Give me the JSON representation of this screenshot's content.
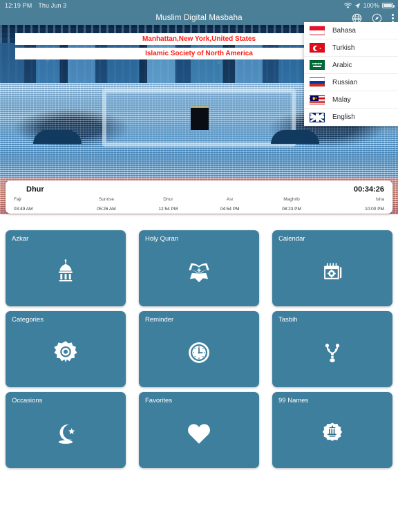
{
  "status_bar": {
    "time": "12:19 PM",
    "date": "Thu Jun 3",
    "battery": "100%",
    "wifi_icon": "wifi-icon",
    "location_icon": "location-arrow-icon",
    "battery_icon": "battery-full-icon"
  },
  "app_bar": {
    "title": "Muslim Digital Masbaha",
    "actions": [
      {
        "name": "globe-icon",
        "label": "Language"
      },
      {
        "name": "compass-icon",
        "label": "Qibla"
      },
      {
        "name": "overflow-menu-icon",
        "label": "More"
      }
    ]
  },
  "hero": {
    "city_banner": "Manhattan,New York,United States",
    "org_banner": "Islamic Society of North America",
    "banner_color": "#ff1a0f"
  },
  "language_menu": {
    "items": [
      {
        "label": "Bahasa",
        "flag": "flag-indonesia"
      },
      {
        "label": "Turkish",
        "flag": "flag-turkey"
      },
      {
        "label": "Arabic",
        "flag": "flag-saudi-arabia"
      },
      {
        "label": "Russian",
        "flag": "flag-russia"
      },
      {
        "label": "Malay",
        "flag": "flag-malaysia"
      },
      {
        "label": "English",
        "flag": "flag-united-kingdom"
      }
    ]
  },
  "prayer_card": {
    "next_prayer": "Dhur",
    "countdown": "00:34:26",
    "times": [
      {
        "name": "Fajr",
        "time": "03:49 AM"
      },
      {
        "name": "Sunrise",
        "time": "05:26 AM"
      },
      {
        "name": "Dhur",
        "time": "12:54 PM"
      },
      {
        "name": "Asr",
        "time": "04:54 PM"
      },
      {
        "name": "Maghrib",
        "time": "08:23 PM"
      },
      {
        "name": "Isha",
        "time": "10:00 PM"
      }
    ]
  },
  "grid": {
    "accent": "#3e7f9e",
    "cards": [
      {
        "label": "Azkar",
        "icon": "mosque-dome-icon"
      },
      {
        "label": "Holy Quran",
        "icon": "open-quran-icon"
      },
      {
        "label": "Calendar",
        "icon": "calendar-settings-icon"
      },
      {
        "label": "Categories",
        "icon": "islamic-rosette-icon"
      },
      {
        "label": "Reminder",
        "icon": "clock-icon"
      },
      {
        "label": "Tasbih",
        "icon": "prayer-beads-icon"
      },
      {
        "label": "Occasions",
        "icon": "crescent-star-icon"
      },
      {
        "label": "Favorites",
        "icon": "heart-icon"
      },
      {
        "label": "99 Names",
        "icon": "allah-badge-icon"
      }
    ]
  }
}
